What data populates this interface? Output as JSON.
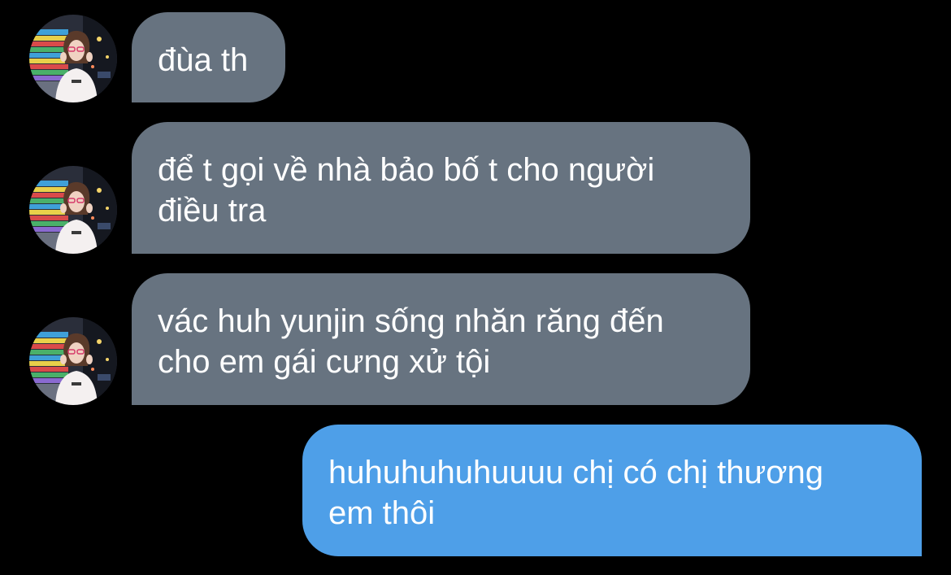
{
  "conversation": {
    "messages": [
      {
        "direction": "incoming",
        "lines": [
          "đùa th"
        ]
      },
      {
        "direction": "incoming",
        "lines": [
          "để t gọi về nhà bảo bố t cho người",
          "điều tra"
        ]
      },
      {
        "direction": "incoming",
        "lines": [
          "vác huh yunjin sống nhăn răng đến",
          "cho em gái cưng xử tội"
        ]
      },
      {
        "direction": "outgoing",
        "lines": [
          "huhuhuhuhuuuu chị có chị thương",
          "em thôi"
        ]
      }
    ]
  },
  "colors": {
    "background": "#000000",
    "incoming_bubble": "#677380",
    "outgoing_bubble": "#4e9fe8",
    "text": "#ffffff"
  },
  "icons": {
    "contact_avatar": "profile-photo-avatar"
  }
}
